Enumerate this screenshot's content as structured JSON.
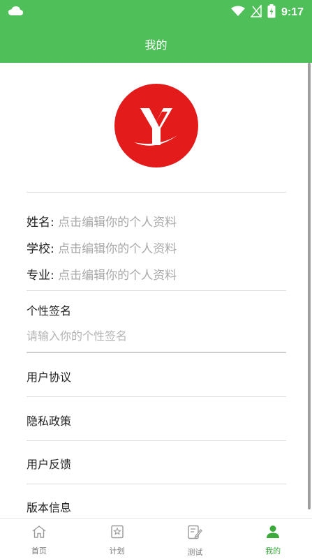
{
  "status_bar": {
    "time": "9:17"
  },
  "app_bar": {
    "title": "我的"
  },
  "profile": {
    "name_label": "姓名:",
    "name_placeholder": "点击编辑你的个人资料",
    "school_label": "学校:",
    "school_placeholder": "点击编辑你的个人资料",
    "major_label": "专业:",
    "major_placeholder": "点击编辑你的个人资料"
  },
  "signature": {
    "title": "个性签名",
    "placeholder": "请输入你的个性签名",
    "value": ""
  },
  "menu": {
    "items": [
      {
        "label": "用户协议"
      },
      {
        "label": "隐私政策"
      },
      {
        "label": "用户反馈"
      },
      {
        "label": "版本信息"
      }
    ]
  },
  "bottom_nav": {
    "items": [
      {
        "label": "首页",
        "icon": "home-icon"
      },
      {
        "label": "计划",
        "icon": "plan-icon"
      },
      {
        "label": "测试",
        "icon": "test-icon"
      },
      {
        "label": "我的",
        "icon": "person-icon"
      }
    ],
    "active_index": 3
  },
  "colors": {
    "primary": "#4fbf5a",
    "logo_red": "#e31b1b",
    "active_tab": "#3aaa3a"
  }
}
